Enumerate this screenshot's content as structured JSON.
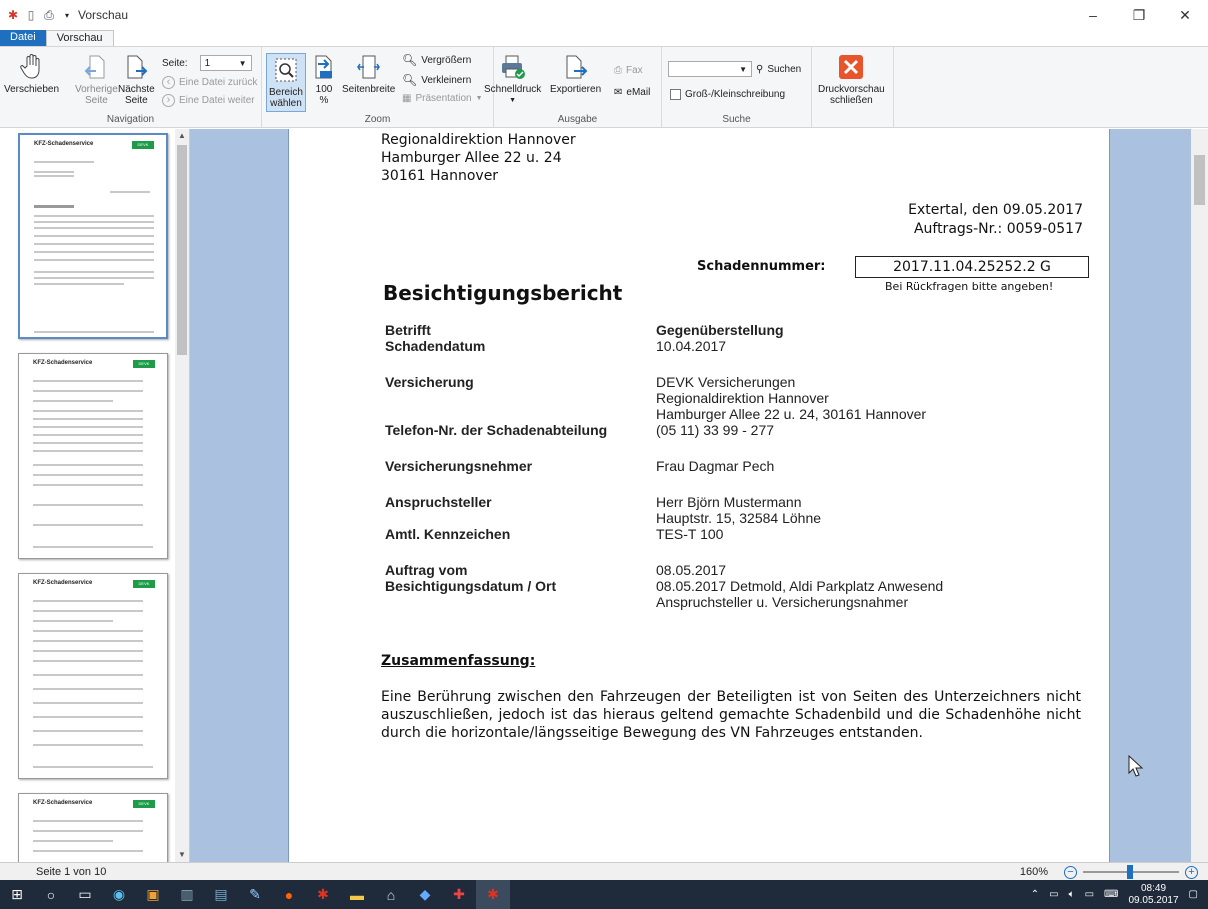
{
  "window": {
    "title": "Vorschau",
    "minimize": "–",
    "maximize": "❐",
    "close": "✕"
  },
  "tabs": [
    {
      "label": "Datei"
    },
    {
      "label": "Vorschau"
    }
  ],
  "ribbon": {
    "navigation": {
      "group_label": "Navigation",
      "verschieben": "Verschieben",
      "vorherige_1": "Vorherige",
      "vorherige_2": "Seite",
      "naechste_1": "Nächste",
      "naechste_2": "Seite",
      "seite_label": "Seite:",
      "seite_value": "1",
      "eine_datei_zurueck": "Eine Datei zurück",
      "eine_datei_weiter": "Eine Datei weiter"
    },
    "zoom": {
      "group_label": "Zoom",
      "bereich_1": "Bereich",
      "bereich_2": "wählen",
      "hundert_1": "100",
      "hundert_2": "%",
      "seitenbreite": "Seitenbreite",
      "vergroessern": "Vergrößern",
      "verkleinern": "Verkleinern",
      "praesentation": "Präsentation"
    },
    "ausgabe": {
      "group_label": "Ausgabe",
      "schnelldruck": "Schnelldruck",
      "exportieren": "Exportieren",
      "fax": "Fax",
      "email": "eMail"
    },
    "suche": {
      "group_label": "Suche",
      "suchen": "Suchen",
      "gross_klein": "Groß-/Kleinschreibung",
      "search_value": ""
    },
    "close": {
      "label_1": "Druckvorschau",
      "label_2": "schließen"
    }
  },
  "thumbnails": {
    "company": "KFZ-Schadenservice",
    "logo": "DEVK"
  },
  "document": {
    "address": [
      "Regionaldirektion Hannover",
      "Hamburger Allee 22 u. 24",
      "30161 Hannover"
    ],
    "place_date": "Extertal, den 09.05.2017",
    "auftrag_nr": "Auftrags-Nr.: 0059-0517",
    "schadennummer_label": "Schadennummer:",
    "schadennummer_value": "2017.11.04.25252.2 G",
    "schadennummer_hint": "Bei Rückfragen bitte angeben!",
    "heading": "Besichtigungsbericht",
    "rows": [
      {
        "k": "Betrifft",
        "v": "Gegenüberstellung",
        "vbold": true,
        "gap": 0
      },
      {
        "k": "Schadendatum",
        "v": "10.04.2017",
        "gap": 0
      },
      {
        "k": "Versicherung",
        "v": "DEVK Versicherungen",
        "gap": 20
      },
      {
        "k": "",
        "v": "Regionaldirektion Hannover",
        "gap": 0
      },
      {
        "k": "",
        "v": "Hamburger Allee 22 u. 24, 30161 Hannover",
        "gap": 0
      },
      {
        "k": "Telefon-Nr. der Schadenabteilung",
        "v": "(05 11) 33 99 - 277",
        "gap": 0
      },
      {
        "k": "Versicherungsnehmer",
        "v": "Frau Dagmar Pech",
        "gap": 20
      },
      {
        "k": "Anspruchsteller",
        "v": "Herr Björn Mustermann",
        "gap": 20
      },
      {
        "k": "",
        "v": "Hauptstr. 15, 32584 Löhne",
        "gap": 0
      },
      {
        "k": "Amtl. Kennzeichen",
        "v": "TES-T 100",
        "gap": 0
      },
      {
        "k": "Auftrag vom",
        "v": "08.05.2017",
        "gap": 20
      },
      {
        "k": "Besichtigungsdatum / Ort",
        "v": "08.05.2017 Detmold, Aldi Parkplatz Anwesend",
        "gap": 0
      },
      {
        "k": "",
        "v": "Anspruchsteller u. Versicherungsnahmer",
        "gap": 0
      }
    ],
    "summary_heading": "Zusammenfassung:",
    "summary_text": "Eine Berührung zwischen den Fahrzeugen der Beteiligten ist von Seiten des Unterzeichners nicht auszuschließen, jedoch ist das hieraus geltend gemachte Schadenbild und die Schadenhöhe nicht durch die horizontale/längsseitige Bewegung des VN Fahrzeuges entstanden."
  },
  "status": {
    "page": "Seite 1 von 10",
    "zoom": "160%",
    "zoom_level_percent": 160
  },
  "taskbar": {
    "time": "08:49",
    "date": "09.05.2017"
  }
}
